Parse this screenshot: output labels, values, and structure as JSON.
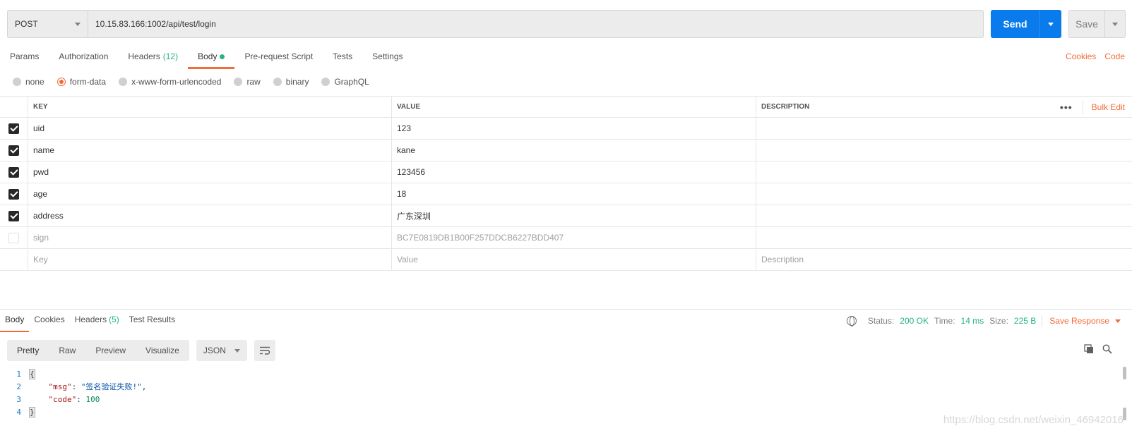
{
  "request": {
    "method": "POST",
    "url": "10.15.83.166:1002/api/test/login",
    "send_label": "Send",
    "save_label": "Save"
  },
  "tabs": [
    {
      "label": "Params"
    },
    {
      "label": "Authorization"
    },
    {
      "label": "Headers",
      "count": "(12)"
    },
    {
      "label": "Body",
      "active": true
    },
    {
      "label": "Pre-request Script"
    },
    {
      "label": "Tests"
    },
    {
      "label": "Settings"
    }
  ],
  "right_links": {
    "cookies": "Cookies",
    "code": "Code"
  },
  "body_types": [
    "none",
    "form-data",
    "x-www-form-urlencoded",
    "raw",
    "binary",
    "GraphQL"
  ],
  "body_type_selected": "form-data",
  "table": {
    "headers": {
      "key": "KEY",
      "value": "VALUE",
      "description": "DESCRIPTION"
    },
    "bulk_edit": "Bulk Edit",
    "more": "•••",
    "rows": [
      {
        "checked": true,
        "key": "uid",
        "value": "123",
        "description": ""
      },
      {
        "checked": true,
        "key": "name",
        "value": "kane",
        "description": ""
      },
      {
        "checked": true,
        "key": "pwd",
        "value": "123456",
        "description": ""
      },
      {
        "checked": true,
        "key": "age",
        "value": "18",
        "description": ""
      },
      {
        "checked": true,
        "key": "address",
        "value": "广东深圳",
        "description": ""
      },
      {
        "checked": false,
        "key": "sign",
        "value": "BC7E0819DB1B00F257DDCB6227BDD407",
        "description": ""
      }
    ],
    "placeholders": {
      "key": "Key",
      "value": "Value",
      "description": "Description"
    }
  },
  "response": {
    "tabs": [
      {
        "label": "Body",
        "active": true
      },
      {
        "label": "Cookies"
      },
      {
        "label": "Headers",
        "count": "(5)"
      },
      {
        "label": "Test Results"
      }
    ],
    "status_label": "Status:",
    "status_value": "200 OK",
    "time_label": "Time:",
    "time_value": "14 ms",
    "size_label": "Size:",
    "size_value": "225 B",
    "save_response": "Save Response",
    "views": [
      "Pretty",
      "Raw",
      "Preview",
      "Visualize"
    ],
    "format": "JSON",
    "code_lines": [
      {
        "n": "1"
      },
      {
        "n": "2",
        "key": "\"msg\"",
        "val": "\"签名验证失败!\""
      },
      {
        "n": "3",
        "key": "\"code\"",
        "val": "100"
      },
      {
        "n": "4"
      }
    ]
  },
  "watermark": "https://blog.csdn.net/weixin_46942016",
  "colors": {
    "accent": "#f26b3a",
    "send": "#097bed",
    "green": "#26b47f"
  }
}
